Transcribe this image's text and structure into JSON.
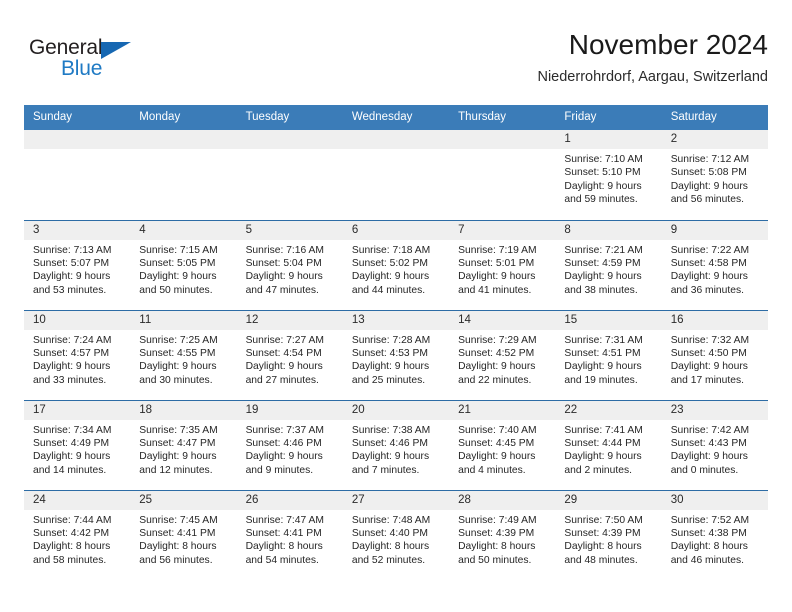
{
  "brand": {
    "word_one": "General",
    "word_two": "Blue",
    "triangle_icon": "triangle-icon",
    "color_dark": "#231f20",
    "color_blue": "#1f7ac4"
  },
  "header": {
    "month_title": "November 2024",
    "location": "Niederrohrdorf, Aargau, Switzerland"
  },
  "theme": {
    "header_blue": "#3b7cb8",
    "row_divider_blue": "#2d6ca5",
    "daynum_band": "#efefef",
    "text": "#262626"
  },
  "calendar": {
    "weekday_headers": [
      "Sunday",
      "Monday",
      "Tuesday",
      "Wednesday",
      "Thursday",
      "Friday",
      "Saturday"
    ],
    "weeks": [
      [
        {
          "day": "",
          "info": ""
        },
        {
          "day": "",
          "info": ""
        },
        {
          "day": "",
          "info": ""
        },
        {
          "day": "",
          "info": ""
        },
        {
          "day": "",
          "info": ""
        },
        {
          "day": "1",
          "info": "Sunrise: 7:10 AM\nSunset: 5:10 PM\nDaylight: 9 hours\nand 59 minutes."
        },
        {
          "day": "2",
          "info": "Sunrise: 7:12 AM\nSunset: 5:08 PM\nDaylight: 9 hours\nand 56 minutes."
        }
      ],
      [
        {
          "day": "3",
          "info": "Sunrise: 7:13 AM\nSunset: 5:07 PM\nDaylight: 9 hours\nand 53 minutes."
        },
        {
          "day": "4",
          "info": "Sunrise: 7:15 AM\nSunset: 5:05 PM\nDaylight: 9 hours\nand 50 minutes."
        },
        {
          "day": "5",
          "info": "Sunrise: 7:16 AM\nSunset: 5:04 PM\nDaylight: 9 hours\nand 47 minutes."
        },
        {
          "day": "6",
          "info": "Sunrise: 7:18 AM\nSunset: 5:02 PM\nDaylight: 9 hours\nand 44 minutes."
        },
        {
          "day": "7",
          "info": "Sunrise: 7:19 AM\nSunset: 5:01 PM\nDaylight: 9 hours\nand 41 minutes."
        },
        {
          "day": "8",
          "info": "Sunrise: 7:21 AM\nSunset: 4:59 PM\nDaylight: 9 hours\nand 38 minutes."
        },
        {
          "day": "9",
          "info": "Sunrise: 7:22 AM\nSunset: 4:58 PM\nDaylight: 9 hours\nand 36 minutes."
        }
      ],
      [
        {
          "day": "10",
          "info": "Sunrise: 7:24 AM\nSunset: 4:57 PM\nDaylight: 9 hours\nand 33 minutes."
        },
        {
          "day": "11",
          "info": "Sunrise: 7:25 AM\nSunset: 4:55 PM\nDaylight: 9 hours\nand 30 minutes."
        },
        {
          "day": "12",
          "info": "Sunrise: 7:27 AM\nSunset: 4:54 PM\nDaylight: 9 hours\nand 27 minutes."
        },
        {
          "day": "13",
          "info": "Sunrise: 7:28 AM\nSunset: 4:53 PM\nDaylight: 9 hours\nand 25 minutes."
        },
        {
          "day": "14",
          "info": "Sunrise: 7:29 AM\nSunset: 4:52 PM\nDaylight: 9 hours\nand 22 minutes."
        },
        {
          "day": "15",
          "info": "Sunrise: 7:31 AM\nSunset: 4:51 PM\nDaylight: 9 hours\nand 19 minutes."
        },
        {
          "day": "16",
          "info": "Sunrise: 7:32 AM\nSunset: 4:50 PM\nDaylight: 9 hours\nand 17 minutes."
        }
      ],
      [
        {
          "day": "17",
          "info": "Sunrise: 7:34 AM\nSunset: 4:49 PM\nDaylight: 9 hours\nand 14 minutes."
        },
        {
          "day": "18",
          "info": "Sunrise: 7:35 AM\nSunset: 4:47 PM\nDaylight: 9 hours\nand 12 minutes."
        },
        {
          "day": "19",
          "info": "Sunrise: 7:37 AM\nSunset: 4:46 PM\nDaylight: 9 hours\nand 9 minutes."
        },
        {
          "day": "20",
          "info": "Sunrise: 7:38 AM\nSunset: 4:46 PM\nDaylight: 9 hours\nand 7 minutes."
        },
        {
          "day": "21",
          "info": "Sunrise: 7:40 AM\nSunset: 4:45 PM\nDaylight: 9 hours\nand 4 minutes."
        },
        {
          "day": "22",
          "info": "Sunrise: 7:41 AM\nSunset: 4:44 PM\nDaylight: 9 hours\nand 2 minutes."
        },
        {
          "day": "23",
          "info": "Sunrise: 7:42 AM\nSunset: 4:43 PM\nDaylight: 9 hours\nand 0 minutes."
        }
      ],
      [
        {
          "day": "24",
          "info": "Sunrise: 7:44 AM\nSunset: 4:42 PM\nDaylight: 8 hours\nand 58 minutes."
        },
        {
          "day": "25",
          "info": "Sunrise: 7:45 AM\nSunset: 4:41 PM\nDaylight: 8 hours\nand 56 minutes."
        },
        {
          "day": "26",
          "info": "Sunrise: 7:47 AM\nSunset: 4:41 PM\nDaylight: 8 hours\nand 54 minutes."
        },
        {
          "day": "27",
          "info": "Sunrise: 7:48 AM\nSunset: 4:40 PM\nDaylight: 8 hours\nand 52 minutes."
        },
        {
          "day": "28",
          "info": "Sunrise: 7:49 AM\nSunset: 4:39 PM\nDaylight: 8 hours\nand 50 minutes."
        },
        {
          "day": "29",
          "info": "Sunrise: 7:50 AM\nSunset: 4:39 PM\nDaylight: 8 hours\nand 48 minutes."
        },
        {
          "day": "30",
          "info": "Sunrise: 7:52 AM\nSunset: 4:38 PM\nDaylight: 8 hours\nand 46 minutes."
        }
      ]
    ]
  }
}
